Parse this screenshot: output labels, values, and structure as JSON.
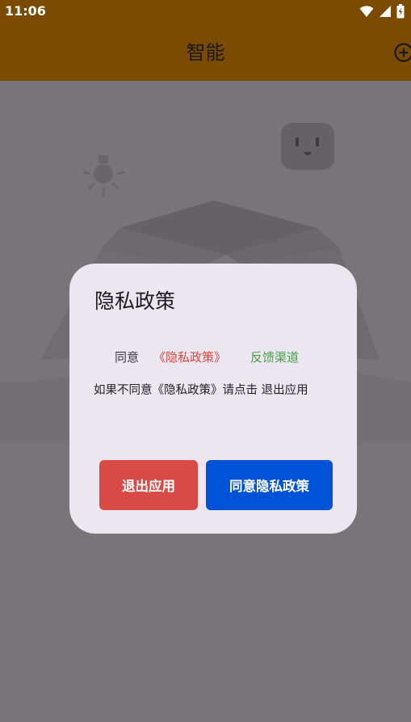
{
  "status_bar": {
    "time": "11:06",
    "icons": [
      "wifi-icon",
      "signal-icon",
      "battery-icon"
    ]
  },
  "app_bar": {
    "title": "智能",
    "action_icon": "add-circle-icon"
  },
  "illustration": {
    "icons": [
      "lightbulb-icon",
      "power-socket-icon",
      "open-box-icon"
    ]
  },
  "dialog": {
    "title": "隐私政策",
    "agree_text": "同意",
    "policy_link": "《隐私政策》",
    "feedback_link": "反馈渠道",
    "notice": "如果不同意《隐私政策》请点击 退出应用",
    "buttons": {
      "exit": "退出应用",
      "agree": "同意隐私政策"
    }
  },
  "colors": {
    "app_bar_bg": "#7a4b00",
    "dialog_bg": "#ece6f1",
    "exit_button": "#d84a45",
    "agree_button": "#0053d6",
    "policy_link": "#e0463a",
    "feedback_link": "#43a047"
  }
}
